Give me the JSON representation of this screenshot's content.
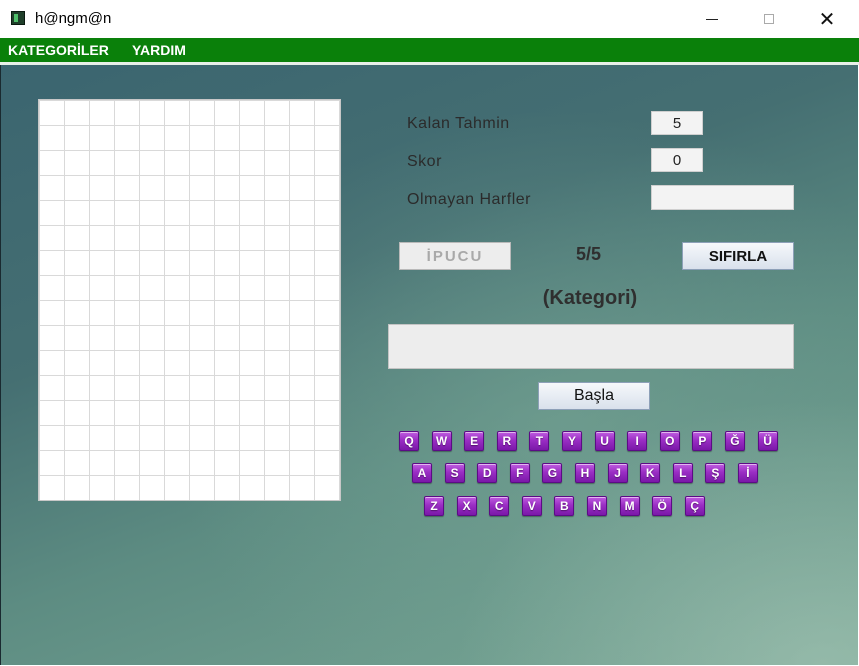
{
  "window": {
    "title": "h@ngm@n",
    "close_glyph": "✕"
  },
  "menu": {
    "items": [
      "KATEGORİLER",
      "YARDIM"
    ]
  },
  "stats": {
    "kalan_label": "Kalan Tahmin",
    "kalan_value": "5",
    "skor_label": "Skor",
    "skor_value": "0",
    "olmayan_label": "Olmayan Harfler",
    "olmayan_value": ""
  },
  "controls": {
    "ipucu_label": "İPUCU",
    "count": "5/5",
    "sifirla_label": "SIFIRLA",
    "kategori": "(Kategori)",
    "word": "",
    "basla_label": "Başla"
  },
  "keyboard": {
    "row1": [
      "Q",
      "W",
      "E",
      "R",
      "T",
      "Y",
      "U",
      "I",
      "O",
      "P",
      "Ğ",
      "Ü"
    ],
    "row2": [
      "A",
      "S",
      "D",
      "F",
      "G",
      "H",
      "J",
      "K",
      "L",
      "Ş",
      "İ"
    ],
    "row3": [
      "Z",
      "X",
      "C",
      "V",
      "B",
      "N",
      "M",
      "Ö",
      "Ç"
    ]
  },
  "colors": {
    "menu_bar": "#0a800a",
    "key_purple": "#9a2ec4"
  }
}
